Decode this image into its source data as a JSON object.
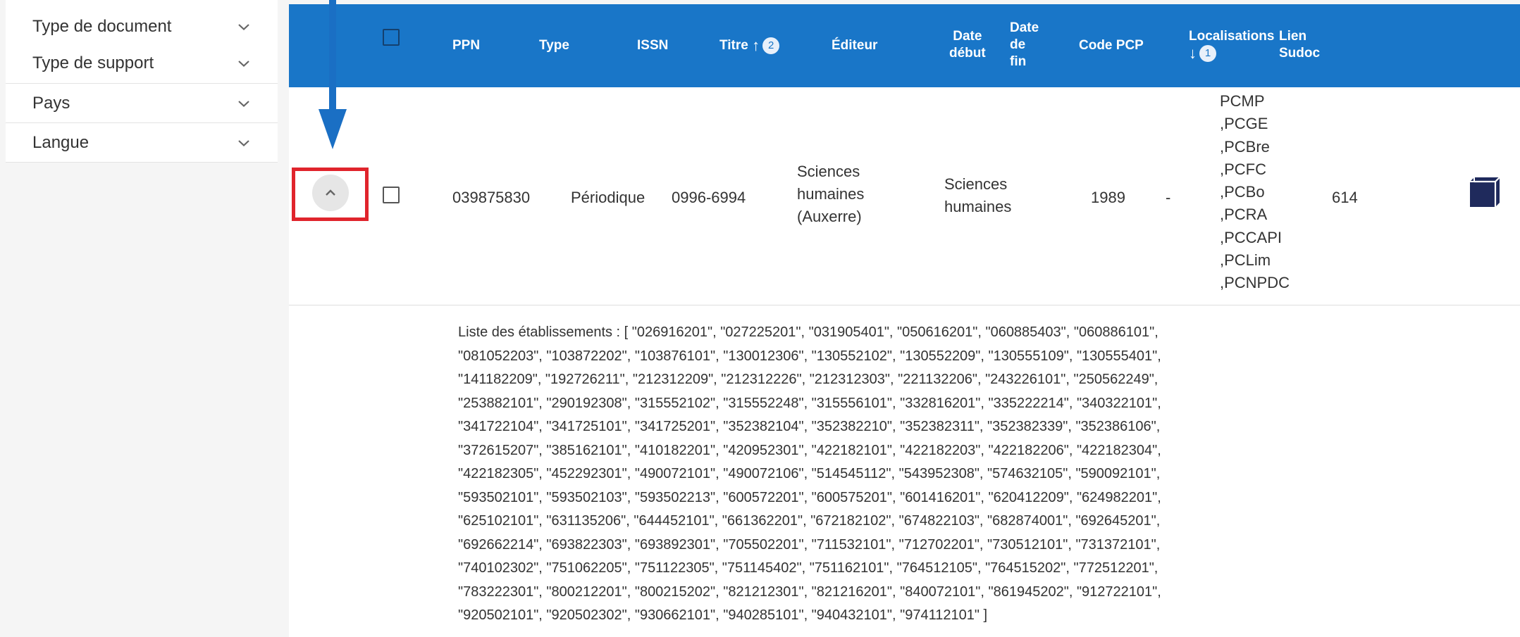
{
  "sidebar": {
    "facets": [
      {
        "label": "Type de document"
      },
      {
        "label": "Type de support"
      },
      {
        "label": "Pays"
      },
      {
        "label": "Langue"
      }
    ]
  },
  "table": {
    "headers": {
      "ppn": "PPN",
      "type": "Type",
      "issn": "ISSN",
      "titre": "Titre",
      "titre_sort_order": "2",
      "editeur": "Éditeur",
      "date_debut_line1": "Date",
      "date_debut_line2": "début",
      "date_fin_line1": "Date",
      "date_fin_line2": "de",
      "date_fin_line3": "fin",
      "code_pcp": "Code PCP",
      "localisations": "Localisations",
      "localisations_sort_order": "1",
      "lien_line1": "Lien",
      "lien_line2": "Sudoc"
    },
    "row": {
      "ppn": "039875830",
      "type": "Périodique",
      "issn": "0996-6994",
      "titre": [
        "Sciences",
        "humaines",
        "(Auxerre)"
      ],
      "editeur": [
        "Sciences",
        "humaines"
      ],
      "date_debut": "1989",
      "date_fin": "-",
      "code_pcp": [
        "PCMP",
        ",PCGE",
        ",PCBre",
        ",PCFC",
        ",PCBo",
        ",PCRA",
        ",PCCAPI",
        ",PCLim",
        ",PCNPDC"
      ],
      "localisations": "614"
    },
    "detail_lines": [
      "Liste des établissements : [ \"026916201\", \"027225201\", \"031905401\", \"050616201\", \"060885403\", \"060886101\",",
      "\"081052203\", \"103872202\", \"103876101\", \"130012306\", \"130552102\", \"130552209\", \"130555109\", \"130555401\",",
      "\"141182209\", \"192726211\", \"212312209\", \"212312226\", \"212312303\", \"221132206\", \"243226101\", \"250562249\",",
      "\"253882101\", \"290192308\", \"315552102\", \"315552248\", \"315556101\", \"332816201\", \"335222214\", \"340322101\",",
      "\"341722104\", \"341725101\", \"341725201\", \"352382104\", \"352382210\", \"352382311\", \"352382339\", \"352386106\",",
      "\"372615207\", \"385162101\", \"410182201\", \"420952301\", \"422182101\", \"422182203\", \"422182206\", \"422182304\",",
      "\"422182305\", \"452292301\", \"490072101\", \"490072106\", \"514545112\", \"543952308\", \"574632105\", \"590092101\",",
      "\"593502101\", \"593502103\", \"593502213\", \"600572201\", \"600575201\", \"601416201\", \"620412209\", \"624982201\",",
      "\"625102101\", \"631135206\", \"644452101\", \"661362201\", \"672182102\", \"674822103\", \"682874001\", \"692645201\",",
      "\"692662214\", \"693822303\", \"693892301\", \"705502201\", \"711532101\", \"712702201\", \"730512101\", \"731372101\",",
      "\"740102302\", \"751062205\", \"751122305\", \"751145402\", \"751162101\", \"764512105\", \"764515202\", \"772512201\",",
      "\"783222301\", \"800212201\", \"800215202\", \"821212301\", \"821216201\", \"840072101\", \"861945202\", \"912722101\",",
      "\"920502101\", \"920502302\", \"930662101\", \"940285101\", \"940432101\", \"974112101\" ]"
    ]
  },
  "colors": {
    "header_bg": "#1976c8",
    "highlight": "#e0242c",
    "annotation_arrow": "#1a6fc4",
    "sudoc_icon": "#1f2a5c"
  },
  "icons": {
    "facet_toggle": "chevron-down-icon",
    "row_toggle": "chevron-up-icon",
    "sudoc_link": "cube-icon",
    "sort_up": "arrow-up-icon",
    "sort_down": "arrow-down-icon"
  }
}
